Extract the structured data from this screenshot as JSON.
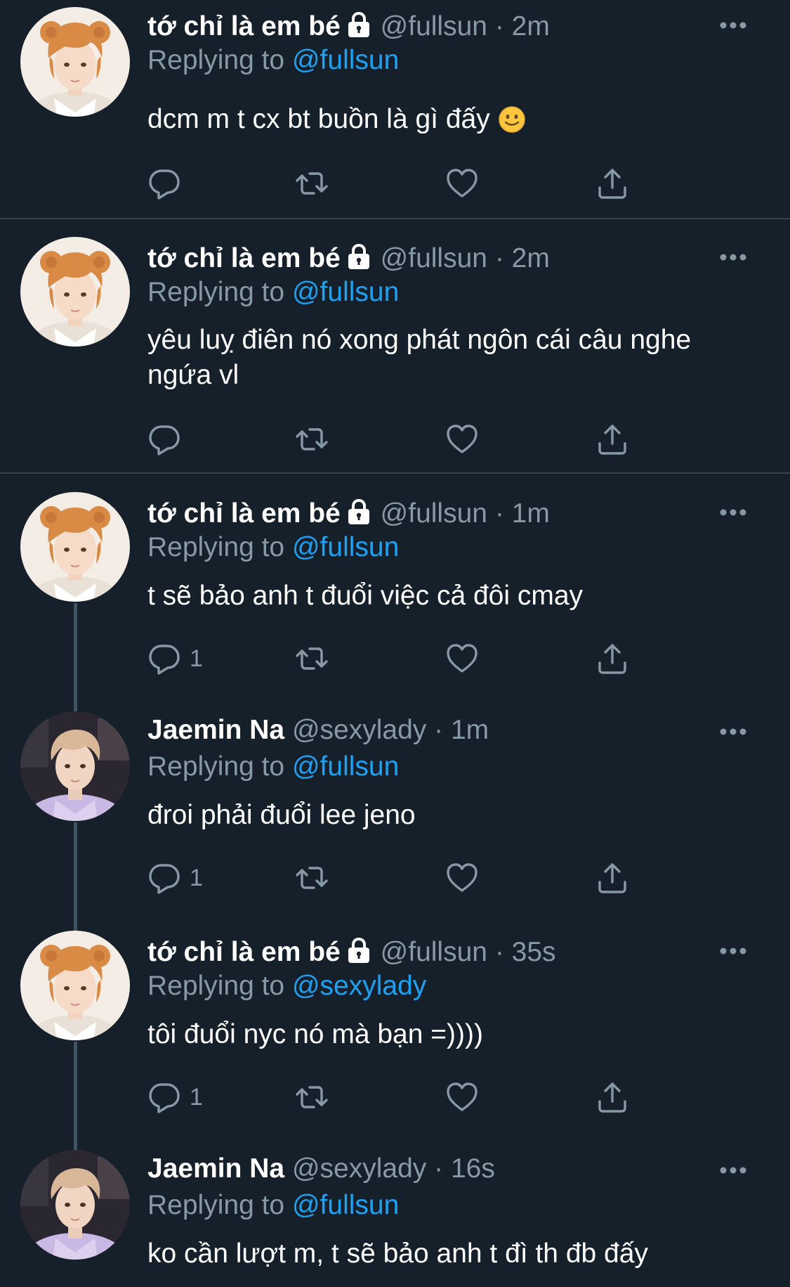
{
  "theme": {
    "background": "#15202b",
    "divider": "#38444d",
    "text_primary": "#ffffff",
    "text_secondary": "#8899a6",
    "accent": "#1da1f2"
  },
  "tweets": [
    {
      "name": "tớ chỉ là em bé",
      "locked": true,
      "handle": "@fullsun",
      "dot": "·",
      "time": "2m",
      "replying_prefix": "Replying to",
      "replying_to": "@fullsun",
      "text": "dcm m t cx bt buồn là gì đấy",
      "emoji": "slightly-smiling-face",
      "reply_count": "",
      "avatar": "avatar-fullsun"
    },
    {
      "name": "tớ chỉ là em bé",
      "locked": true,
      "handle": "@fullsun",
      "dot": "·",
      "time": "2m",
      "replying_prefix": "Replying to",
      "replying_to": "@fullsun",
      "text": "yêu luỵ điên nó xong phát ngôn cái câu nghe ngứa vl",
      "reply_count": "",
      "avatar": "avatar-fullsun"
    },
    {
      "name": "tớ chỉ là em bé",
      "locked": true,
      "handle": "@fullsun",
      "dot": "·",
      "time": "1m",
      "replying_prefix": "Replying to",
      "replying_to": "@fullsun",
      "text": "t sẽ bảo anh t đuổi việc cả đôi cmay",
      "reply_count": "1",
      "avatar": "avatar-fullsun"
    },
    {
      "name": "Jaemin Na",
      "locked": false,
      "handle": "@sexylady",
      "dot": "·",
      "time": "1m",
      "replying_prefix": "Replying to",
      "replying_to": "@fullsun",
      "text": "đroi phải đuổi lee jeno",
      "reply_count": "1",
      "avatar": "avatar-sexylady"
    },
    {
      "name": "tớ chỉ là em bé",
      "locked": true,
      "handle": "@fullsun",
      "dot": "·",
      "time": "35s",
      "replying_prefix": "Replying to",
      "replying_to": "@sexylady",
      "text": "tôi đuổi nyc nó mà bạn =))))",
      "reply_count": "1",
      "avatar": "avatar-fullsun"
    },
    {
      "name": "Jaemin Na",
      "locked": false,
      "handle": "@sexylady",
      "dot": "·",
      "time": "16s",
      "replying_prefix": "Replying to",
      "replying_to": "@fullsun",
      "text": "ko cần lượt m, t sẽ bảo anh t đì th đb đấy",
      "reply_count": "",
      "avatar": "avatar-sexylady"
    }
  ]
}
